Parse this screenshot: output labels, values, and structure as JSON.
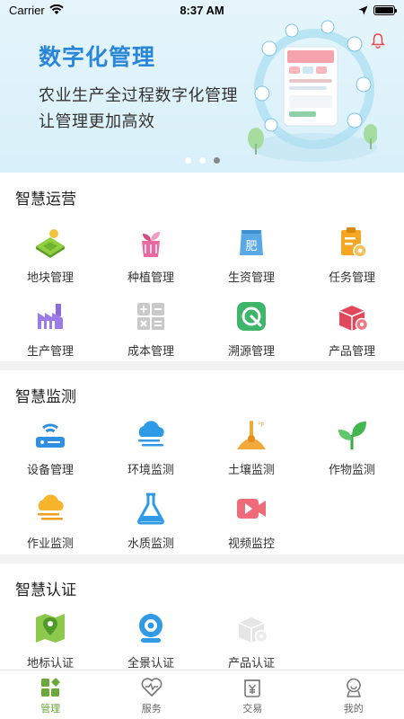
{
  "status": {
    "carrier": "Carrier",
    "time": "8:37 AM"
  },
  "banner": {
    "title": "数字化管理",
    "line1": "农业生产全过程数字化管理",
    "line2": "让管理更加高效",
    "active_dot": 3
  },
  "sections": [
    {
      "title": "智慧运营",
      "items": [
        {
          "label": "地块管理",
          "icon": "land-icon"
        },
        {
          "label": "种植管理",
          "icon": "planting-icon"
        },
        {
          "label": "生资管理",
          "icon": "fertilizer-icon"
        },
        {
          "label": "任务管理",
          "icon": "task-icon"
        },
        {
          "label": "生产管理",
          "icon": "factory-icon"
        },
        {
          "label": "成本管理",
          "icon": "calculator-icon"
        },
        {
          "label": "溯源管理",
          "icon": "trace-icon"
        },
        {
          "label": "产品管理",
          "icon": "product-box-icon"
        }
      ]
    },
    {
      "title": "智慧监测",
      "items": [
        {
          "label": "设备管理",
          "icon": "router-icon"
        },
        {
          "label": "环境监测",
          "icon": "cloud-icon"
        },
        {
          "label": "土壤监测",
          "icon": "soil-thermometer-icon"
        },
        {
          "label": "作物监测",
          "icon": "leaf-icon"
        },
        {
          "label": "作业监测",
          "icon": "cloud-work-icon"
        },
        {
          "label": "水质监测",
          "icon": "flask-icon"
        },
        {
          "label": "视频监控",
          "icon": "video-icon"
        }
      ]
    },
    {
      "title": "智慧认证",
      "items": [
        {
          "label": "地标认证",
          "icon": "map-pin-icon"
        },
        {
          "label": "全景认证",
          "icon": "camera-icon"
        },
        {
          "label": "产品认证",
          "icon": "product-cert-icon"
        }
      ]
    }
  ],
  "tabs": [
    {
      "label": "管理",
      "icon": "grid-icon",
      "active": true
    },
    {
      "label": "服务",
      "icon": "heart-icon",
      "active": false
    },
    {
      "label": "交易",
      "icon": "yuan-icon",
      "active": false
    },
    {
      "label": "我的",
      "icon": "profile-icon",
      "active": false
    }
  ],
  "colors": {
    "accent": "#6aa83a",
    "banner_title": "#2a86d8"
  }
}
